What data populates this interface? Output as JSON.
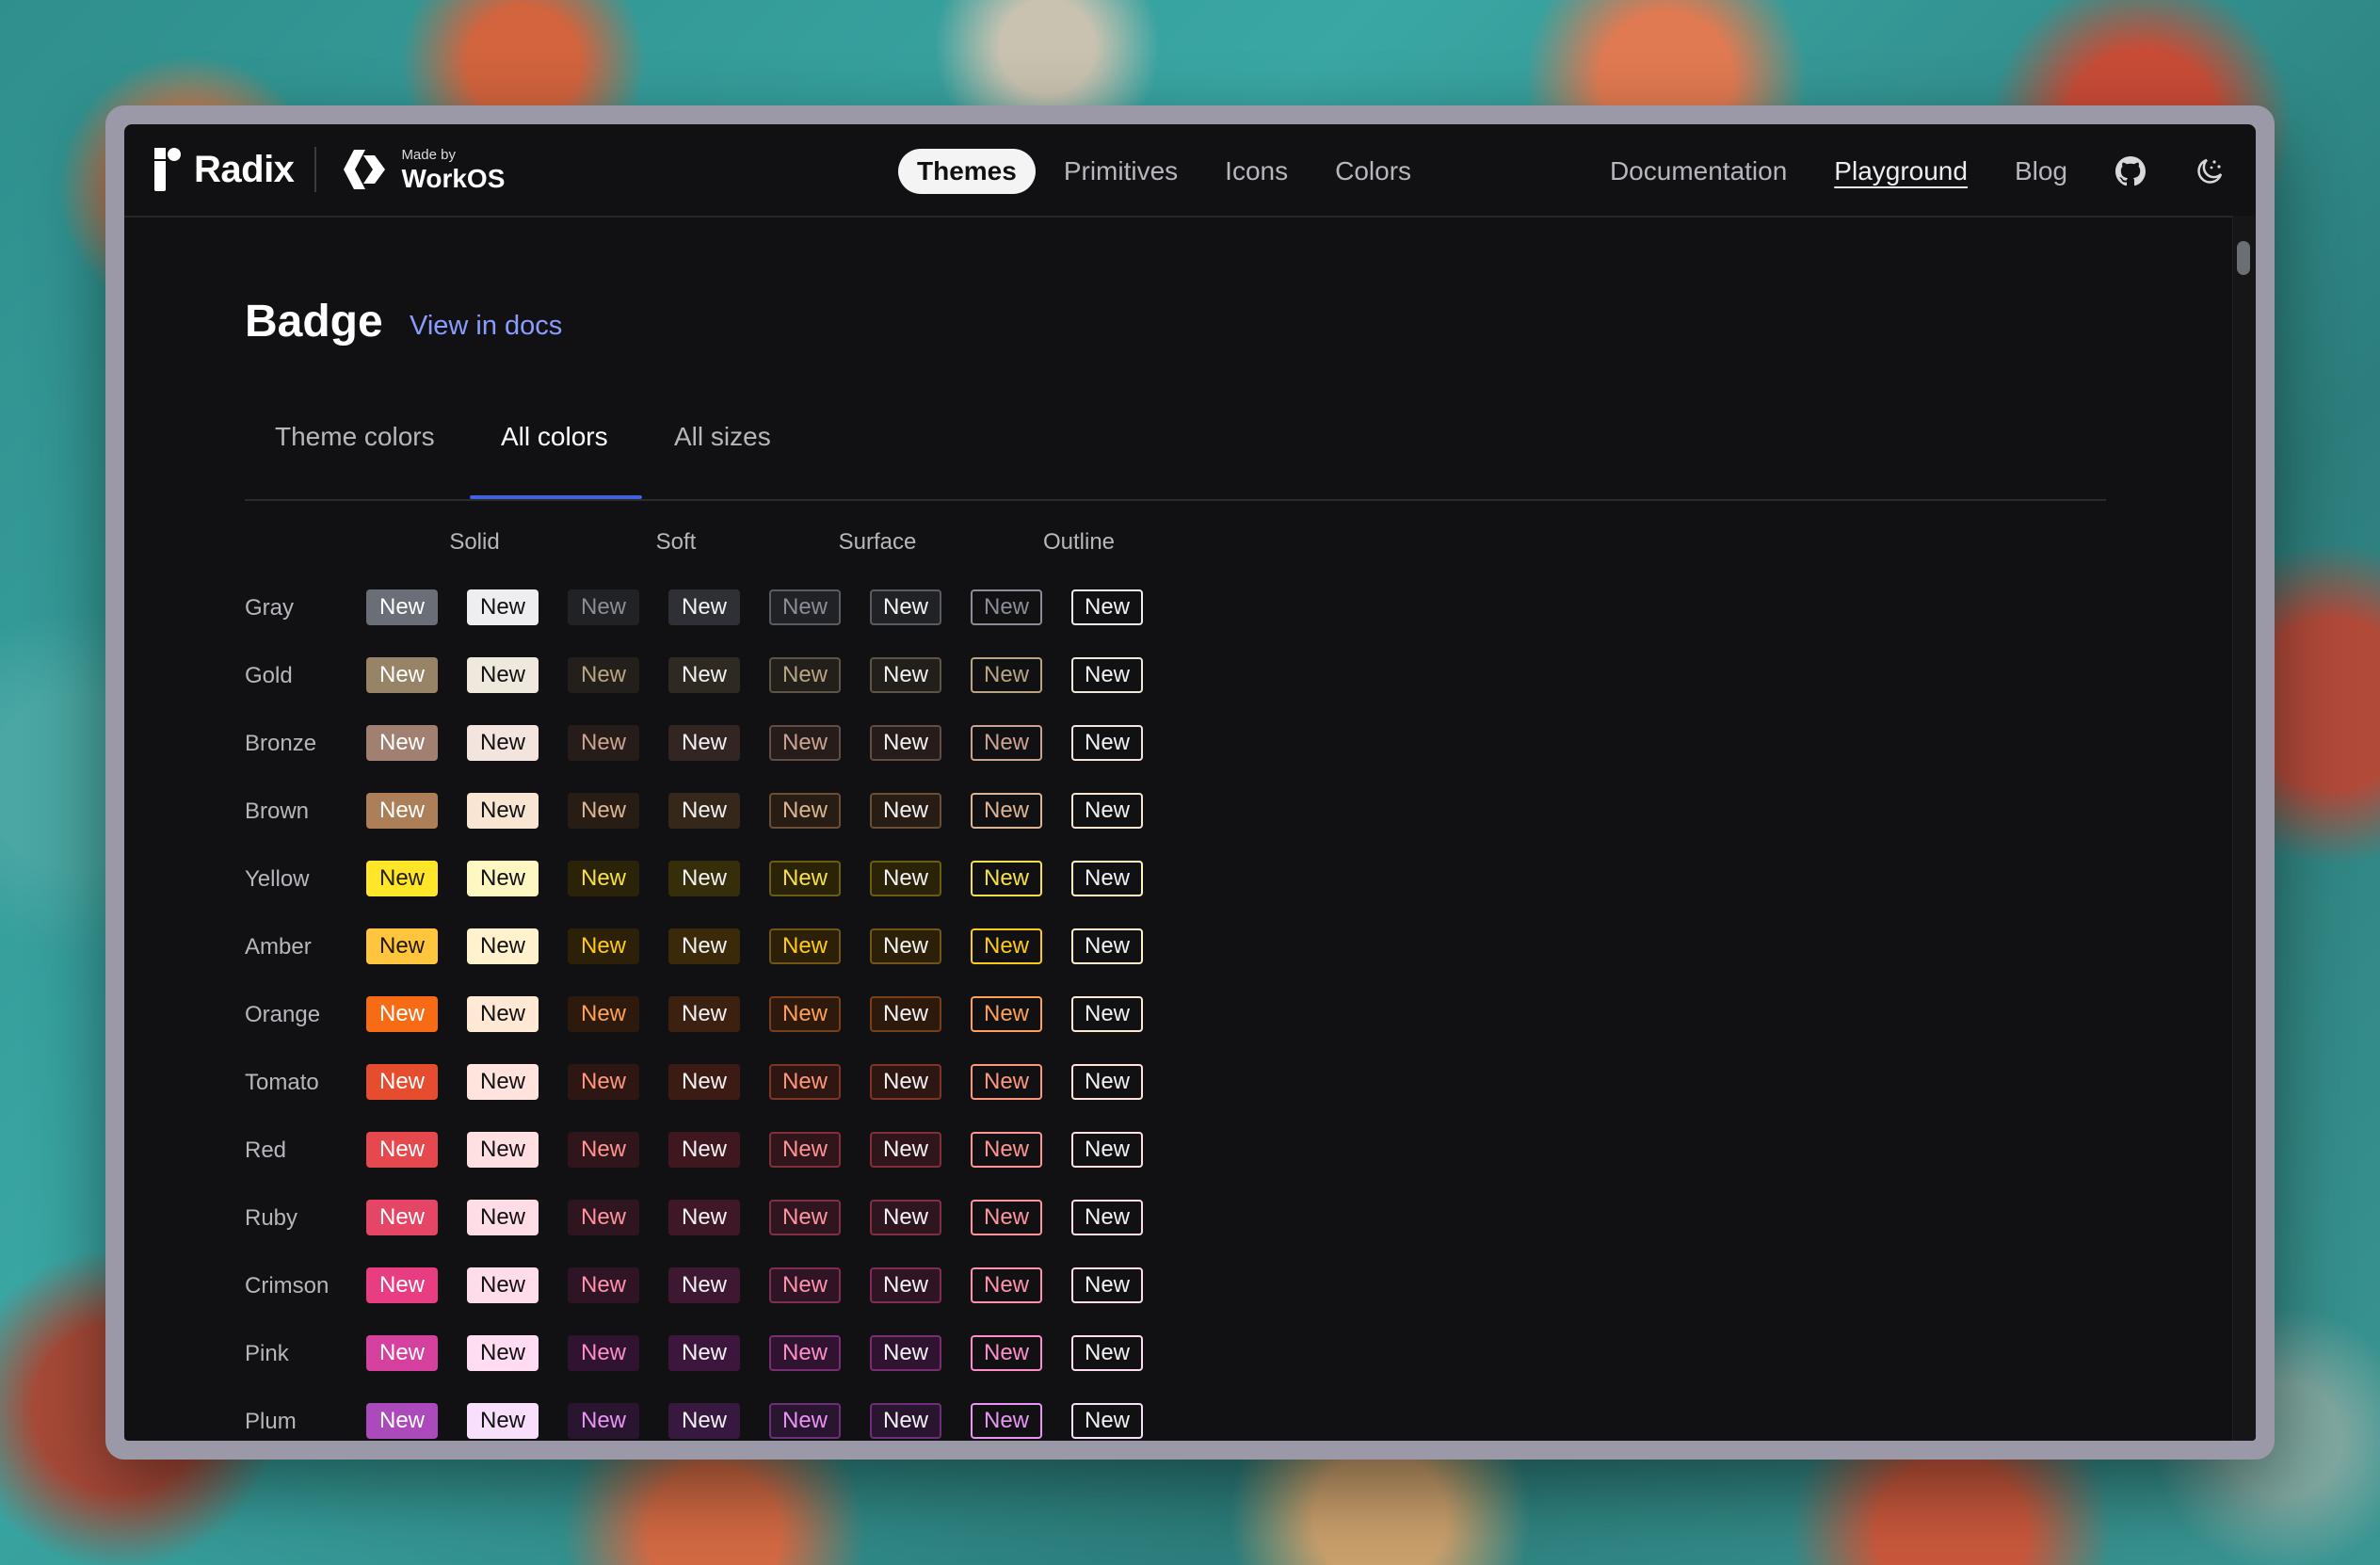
{
  "nav": {
    "brand": "Radix",
    "workos_small": "Made by",
    "workos_name": "WorkOS",
    "center": [
      "Themes",
      "Primitives",
      "Icons",
      "Colors"
    ],
    "active_center": "Themes",
    "right": [
      "Documentation",
      "Playground",
      "Blog"
    ],
    "underlined_right": "Playground",
    "icons": [
      "github-icon",
      "theme-toggle-icon"
    ]
  },
  "page": {
    "title": "Badge",
    "docs_link": "View in docs",
    "tabs": [
      "Theme colors",
      "All colors",
      "All sizes"
    ],
    "active_tab": "All colors",
    "columns": [
      "Solid",
      "Soft",
      "Surface",
      "Outline"
    ],
    "badge_text": "New"
  },
  "colors": [
    {
      "name": "Gray",
      "accent": "#8b8d98",
      "solid": "#696e77",
      "light": "#c7cbd1",
      "pale": "#eeeef0",
      "soft_bg": "#212225",
      "soft_bg2": "#2e3035",
      "surf_border": "#5a5c63"
    },
    {
      "name": "Gold",
      "accent": "#b8a584",
      "solid": "#978365",
      "light": "#ddd0b8",
      "pale": "#efe9dd",
      "soft_bg": "#231f1a",
      "soft_bg2": "#2e2a22",
      "surf_border": "#5d5445"
    },
    {
      "name": "Bronze",
      "accent": "#cba393",
      "solid": "#a18072",
      "light": "#e7c8bc",
      "pale": "#f3e4dd",
      "soft_bg": "#261d1a",
      "soft_bg2": "#332622",
      "surf_border": "#634c43"
    },
    {
      "name": "Brown",
      "accent": "#dbb594",
      "solid": "#ad7f58",
      "light": "#f0cdab",
      "pale": "#f8e6d3",
      "soft_bg": "#281d15",
      "soft_bg2": "#35271a",
      "surf_border": "#6a4e35"
    },
    {
      "name": "Yellow",
      "accent": "#f5e147",
      "solid": "#ffe629",
      "light": "#fff199",
      "pale": "#fff7c2",
      "soft_bg": "#2a2308",
      "soft_bg2": "#362d09",
      "surf_border": "#6b5d10",
      "solid_text": "#211f00"
    },
    {
      "name": "Amber",
      "accent": "#ffca16",
      "solid": "#ffc53d",
      "light": "#ffe29f",
      "pale": "#fff2cc",
      "soft_bg": "#2c2108",
      "soft_bg2": "#3a2a09",
      "surf_border": "#715515",
      "solid_text": "#211800"
    },
    {
      "name": "Orange",
      "accent": "#ffa057",
      "solid": "#f76b15",
      "light": "#ffcca7",
      "pale": "#ffe8d4",
      "soft_bg": "#2e1a0d",
      "soft_bg2": "#3d2110",
      "surf_border": "#7a3e18"
    },
    {
      "name": "Tomato",
      "accent": "#ff977d",
      "solid": "#e54d2e",
      "light": "#fbc3b6",
      "pale": "#ffe3dc",
      "soft_bg": "#2e1713",
      "soft_bg2": "#3d1b15",
      "surf_border": "#7f3425"
    },
    {
      "name": "Red",
      "accent": "#ff9592",
      "solid": "#e5484d",
      "light": "#fbc4c6",
      "pale": "#ffdfe2",
      "soft_bg": "#30151a",
      "soft_bg2": "#3f181f",
      "surf_border": "#813037"
    },
    {
      "name": "Ruby",
      "accent": "#ff949d",
      "solid": "#e54666",
      "light": "#fbc2cd",
      "pale": "#ffdde6",
      "soft_bg": "#2f1520",
      "soft_bg2": "#3f1827",
      "surf_border": "#802f45"
    },
    {
      "name": "Crimson",
      "accent": "#ff92ad",
      "solid": "#e93d82",
      "light": "#f9c2d7",
      "pale": "#ffdcea",
      "soft_bg": "#2f1426",
      "soft_bg2": "#3e1731",
      "surf_border": "#802d55"
    },
    {
      "name": "Pink",
      "accent": "#ff8dcc",
      "solid": "#d6409f",
      "light": "#f5c1e0",
      "pale": "#ffdcf2",
      "soft_bg": "#2f1330",
      "soft_bg2": "#3d163e",
      "surf_border": "#7a2d72"
    },
    {
      "name": "Plum",
      "accent": "#e796f3",
      "solid": "#ab4aba",
      "light": "#eec3f2",
      "pale": "#f8dffb",
      "soft_bg": "#2a1531",
      "soft_bg2": "#37183f",
      "surf_border": "#6c3076"
    }
  ]
}
